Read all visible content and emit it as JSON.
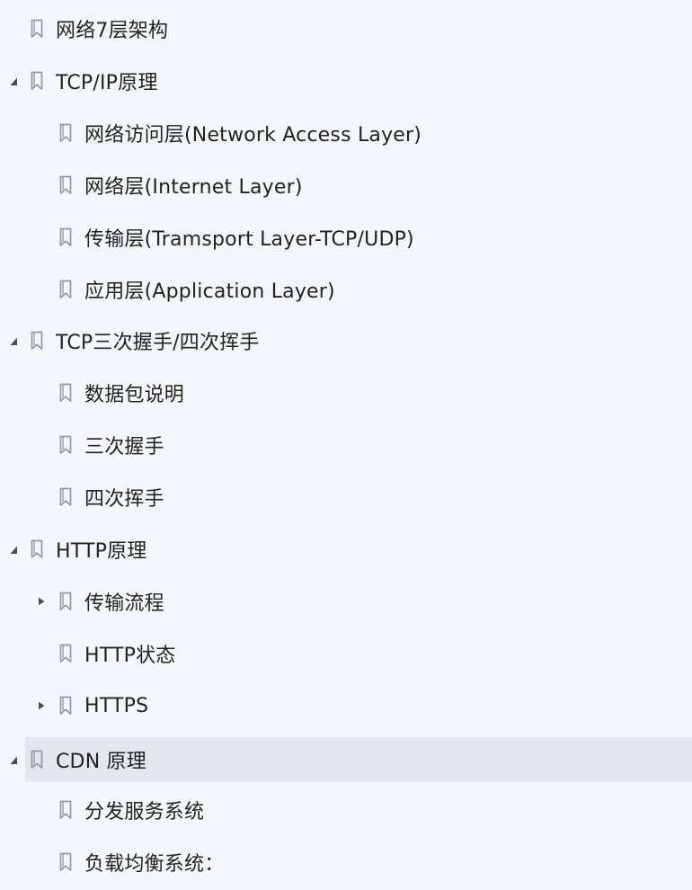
{
  "colors": {
    "background": "#f3f6fb",
    "selected_row": "#e3e6ea",
    "text": "#222222",
    "icon_stroke": "#8f9aa6"
  },
  "items": [
    {
      "label": "网络7层架构",
      "level": 0,
      "expander": "none",
      "icon": "bookmark-icon",
      "selected": false
    },
    {
      "label": "TCP/IP原理",
      "level": 0,
      "expander": "expanded",
      "icon": "bookmark-icon",
      "selected": false
    },
    {
      "label": "网络访问层(Network Access Layer)",
      "level": 1,
      "expander": "none",
      "icon": "bookmark-icon",
      "selected": false
    },
    {
      "label": "网络层(Internet Layer)",
      "level": 1,
      "expander": "none",
      "icon": "bookmark-icon",
      "selected": false
    },
    {
      "label": "传输层(Tramsport Layer-TCP/UDP)",
      "level": 1,
      "expander": "none",
      "icon": "bookmark-icon",
      "selected": false
    },
    {
      "label": "应用层(Application Layer)",
      "level": 1,
      "expander": "none",
      "icon": "bookmark-icon",
      "selected": false
    },
    {
      "label": "TCP三次握手/四次挥手",
      "level": 0,
      "expander": "expanded",
      "icon": "bookmark-icon",
      "selected": false
    },
    {
      "label": "数据包说明",
      "level": 1,
      "expander": "none",
      "icon": "bookmark-icon",
      "selected": false
    },
    {
      "label": "三次握手",
      "level": 1,
      "expander": "none",
      "icon": "bookmark-icon",
      "selected": false
    },
    {
      "label": "四次挥手",
      "level": 1,
      "expander": "none",
      "icon": "bookmark-icon",
      "selected": false
    },
    {
      "label": "HTTP原理",
      "level": 0,
      "expander": "expanded",
      "icon": "bookmark-icon",
      "selected": false
    },
    {
      "label": "传输流程",
      "level": 1,
      "expander": "collapsed",
      "icon": "bookmark-icon",
      "selected": false
    },
    {
      "label": "HTTP状态",
      "level": 1,
      "expander": "none",
      "icon": "bookmark-icon",
      "selected": false
    },
    {
      "label": "HTTPS",
      "level": 1,
      "expander": "collapsed",
      "icon": "bookmark-icon",
      "selected": false
    },
    {
      "label": "CDN 原理",
      "level": 0,
      "expander": "expanded",
      "icon": "bookmark-icon",
      "selected": true
    },
    {
      "label": "分发服务系统",
      "level": 1,
      "expander": "none",
      "icon": "bookmark-icon",
      "selected": false
    },
    {
      "label": "负载均衡系统：",
      "level": 1,
      "expander": "none",
      "icon": "bookmark-icon",
      "selected": false
    }
  ]
}
